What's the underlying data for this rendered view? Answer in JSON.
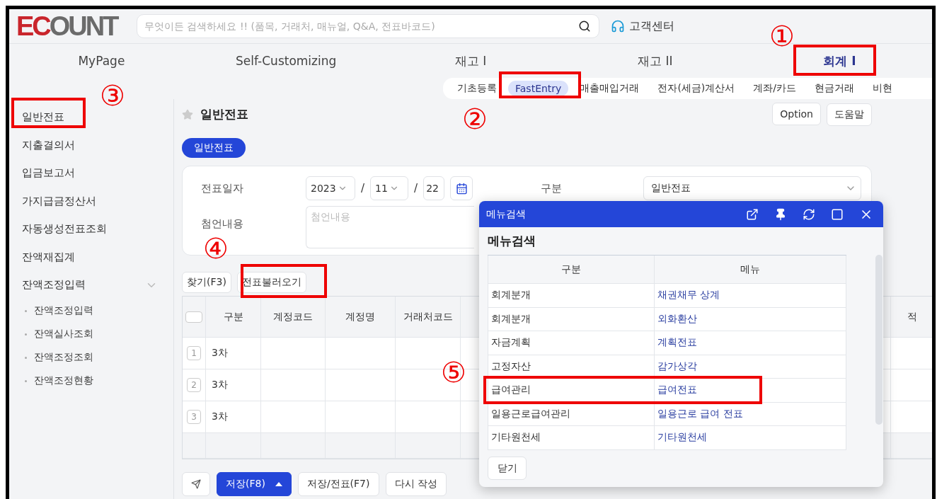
{
  "header": {
    "logo": "ECOUNT",
    "search": {
      "placeholder": "무엇이든 검색하세요 !! (품목, 거래처, 매뉴얼, Q&A, 전표바코드)"
    },
    "support": "고객센터"
  },
  "main_nav": [
    {
      "label": "MyPage",
      "selected": false
    },
    {
      "label": "Self-Customizing",
      "selected": false
    },
    {
      "label": "재고 I",
      "selected": false
    },
    {
      "label": "재고 II",
      "selected": false
    },
    {
      "label": "회계 I",
      "selected": true
    }
  ],
  "sub_nav": [
    {
      "label": "기초등록",
      "selected": false
    },
    {
      "label": "FastEntry",
      "selected": true
    },
    {
      "label": "매출매입거래",
      "selected": false
    },
    {
      "label": "전자(세금)계산서",
      "selected": false
    },
    {
      "label": "계좌/카드",
      "selected": false
    },
    {
      "label": "현금거래",
      "selected": false
    },
    {
      "label": "비현",
      "selected": false
    }
  ],
  "sidebar": {
    "items": [
      {
        "label": "일반전표"
      },
      {
        "label": "지출결의서"
      },
      {
        "label": "입금보고서"
      },
      {
        "label": "가지급금정산서"
      },
      {
        "label": "자동생성전표조회"
      },
      {
        "label": "잔액재집계"
      },
      {
        "label": "잔액조정입력",
        "expanded": true,
        "children": [
          {
            "label": "잔액조정입력"
          },
          {
            "label": "잔액실사조회"
          },
          {
            "label": "잔액조정조회"
          },
          {
            "label": "잔액조정현황"
          }
        ]
      }
    ]
  },
  "page": {
    "title": "일반전표",
    "buttons": [
      "Option",
      "도움말"
    ],
    "tabs": [
      {
        "label": "일반전표",
        "selected": true
      }
    ]
  },
  "form": {
    "date_label": "전표일자",
    "year": "2023",
    "month": "11",
    "day": "22",
    "separator": "/",
    "type_label": "구분",
    "type_value": "일반전표",
    "memo_label": "첨언내용",
    "memo_placeholder": "첨언내용"
  },
  "grid_buttons": [
    "찾기(F3)",
    "전표불러오기"
  ],
  "table": {
    "select_all_checked": false,
    "columns": [
      "구분",
      "계정코드",
      "계정명",
      "거래처코드"
    ],
    "column_edge": "적",
    "rows": [
      {
        "number": "1",
        "type": "3차"
      },
      {
        "number": "2",
        "type": "3차"
      },
      {
        "number": "3",
        "type": "3차"
      }
    ]
  },
  "footer_buttons": [
    {
      "kind": "icon"
    },
    {
      "kind": "primary",
      "label": "저장(F8)"
    },
    {
      "kind": "plain",
      "label": "저장/전표(F7)"
    },
    {
      "kind": "plain",
      "label": "다시 작성"
    }
  ],
  "dialog": {
    "title": "메뉴검색",
    "heading": "메뉴검색",
    "columns": [
      "구분",
      "메뉴"
    ],
    "rows": [
      {
        "category": "회계분개",
        "menu": "채권채무 상계"
      },
      {
        "category": "회계분개",
        "menu": "외화환산"
      },
      {
        "category": "자금계획",
        "menu": "계획전표"
      },
      {
        "category": "고정자산",
        "menu": "감가상각"
      },
      {
        "category": "급여관리",
        "menu": "급여전표"
      },
      {
        "category": "일용근로급여관리",
        "menu": "일용근로 급여 전표"
      },
      {
        "category": "기타원천세",
        "menu": "기타원천세"
      }
    ],
    "close": "닫기"
  },
  "annotations": [
    {
      "mark": "①"
    },
    {
      "mark": "②"
    },
    {
      "mark": "③"
    },
    {
      "mark": "④"
    },
    {
      "mark": "⑤"
    }
  ]
}
